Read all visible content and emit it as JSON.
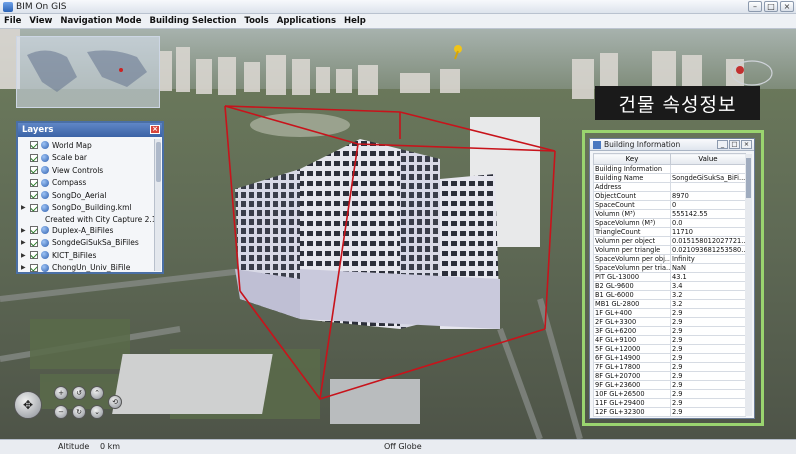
{
  "window": {
    "title": "BIM On GIS"
  },
  "menu": [
    "File",
    "View",
    "Navigation Mode",
    "Building Selection",
    "Tools",
    "Applications",
    "Help"
  ],
  "overlay_label": "건물 속성정보",
  "layers_panel": {
    "title": "Layers",
    "items": [
      {
        "label": "World Map",
        "checked": true,
        "expander": false,
        "icon": true
      },
      {
        "label": "Scale bar",
        "checked": true,
        "expander": false,
        "icon": true
      },
      {
        "label": "View Controls",
        "checked": true,
        "expander": false,
        "icon": true
      },
      {
        "label": "Compass",
        "checked": true,
        "expander": false,
        "icon": true
      },
      {
        "label": "SongDo_Aerial",
        "checked": true,
        "expander": false,
        "icon": true
      },
      {
        "label": "SongDo_Building.kml",
        "checked": true,
        "expander": true,
        "icon": true
      },
      {
        "label": "Created with City Capture 2.1",
        "sub": true
      },
      {
        "label": "Duplex-A_BiFiles",
        "checked": true,
        "expander": true,
        "icon": true
      },
      {
        "label": "SongdeGiSukSa_BiFiles",
        "checked": true,
        "expander": true,
        "icon": true
      },
      {
        "label": "KICT_BiFiles",
        "checked": true,
        "expander": true,
        "icon": true
      },
      {
        "label": "ChongUn_Univ_BiFile",
        "checked": true,
        "expander": true,
        "icon": true
      }
    ]
  },
  "building_info": {
    "title": "Building Information",
    "columns": [
      "Key",
      "Value"
    ],
    "rows": [
      [
        "Building Information",
        ""
      ],
      [
        "Building Name",
        "SongdeGiSukSa_BiFi..."
      ],
      [
        "Address",
        ""
      ],
      [
        "ObjectCount",
        "8970"
      ],
      [
        "SpaceCount",
        "0"
      ],
      [
        "Volumn (M³)",
        "555142.55"
      ],
      [
        "SpaceVolumn (M³)",
        "0.0"
      ],
      [
        "TriangleCount",
        "11710"
      ],
      [
        "Volumn per object",
        "0.015158012027721..."
      ],
      [
        "Volumn per triangle",
        "0.021093681253580..."
      ],
      [
        "SpaceVolumn per obj...",
        "Infinity"
      ],
      [
        "SpaceVolumn per tria...",
        "NaN"
      ],
      [
        "PIT GL-13000",
        "43.1"
      ],
      [
        "B2 GL-9600",
        "3.4"
      ],
      [
        "B1 GL-6000",
        "3.2"
      ],
      [
        "MB1 GL-2800",
        "3.2"
      ],
      [
        "1F GL+400",
        "2.9"
      ],
      [
        "2F GL+3300",
        "2.9"
      ],
      [
        "3F GL+6200",
        "2.9"
      ],
      [
        "4F GL+9100",
        "2.9"
      ],
      [
        "5F GL+12000",
        "2.9"
      ],
      [
        "6F GL+14900",
        "2.9"
      ],
      [
        "7F GL+17800",
        "2.9"
      ],
      [
        "8F GL+20700",
        "2.9"
      ],
      [
        "9F GL+23600",
        "2.9"
      ],
      [
        "10F GL+26500",
        "2.9"
      ],
      [
        "11F GL+29400",
        "2.9"
      ],
      [
        "12F GL+32300",
        "2.9"
      ]
    ]
  },
  "status": {
    "altitude_label": "Altitude",
    "altitude_value": "0 km",
    "globe_state": "Off Globe"
  }
}
